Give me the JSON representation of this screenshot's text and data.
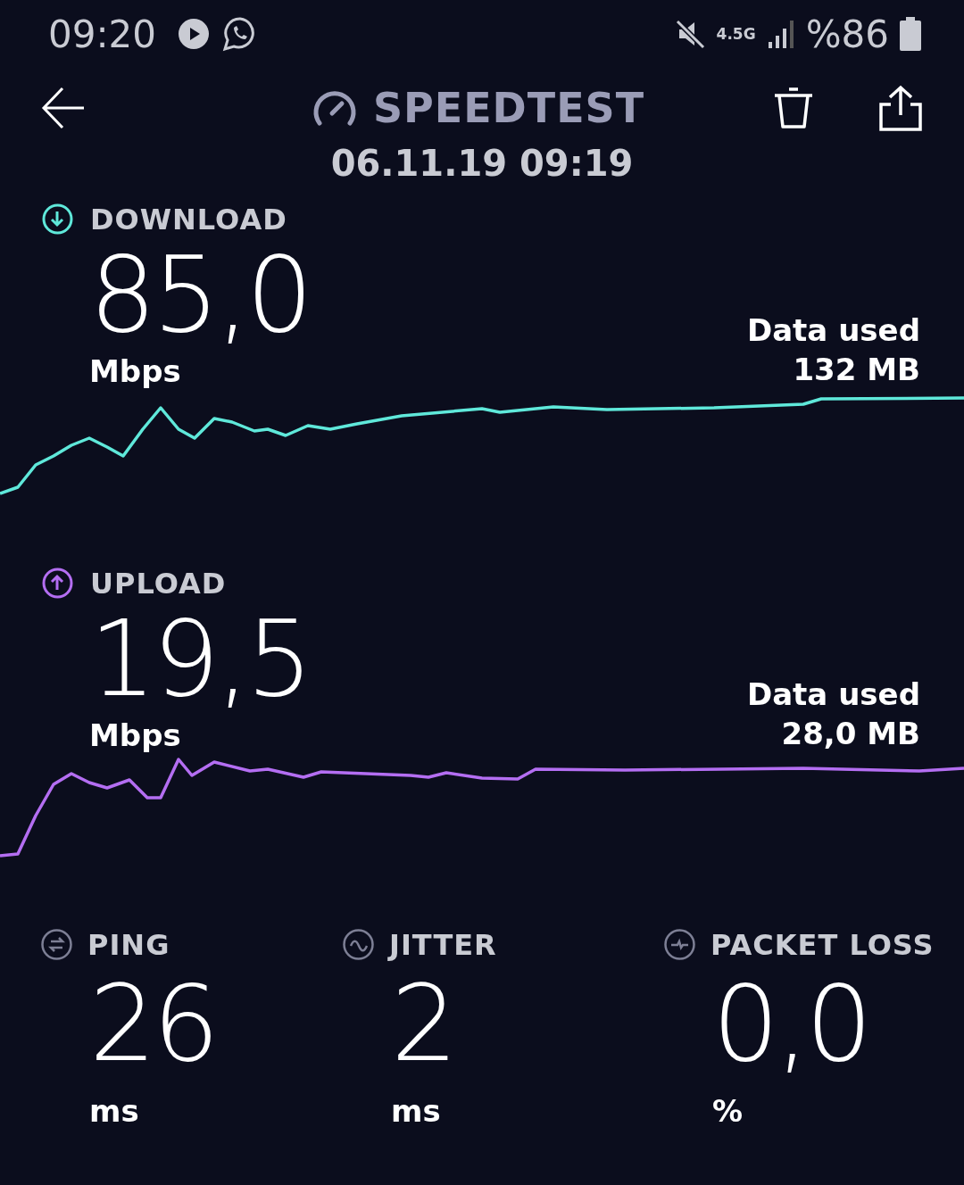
{
  "status_bar": {
    "time": "09:20",
    "network": "4.5G",
    "battery": "%86"
  },
  "header": {
    "title": "SPEEDTEST",
    "date": "06.11.19 09:19"
  },
  "tests": [
    {
      "kind": "download",
      "label": "DOWNLOAD",
      "value": "85,0",
      "unit": "Mbps",
      "data_used_label": "Data used",
      "data_used": "132 MB",
      "color": "#5fe8da"
    },
    {
      "kind": "upload",
      "label": "UPLOAD",
      "value": "19,5",
      "unit": "Mbps",
      "data_used_label": "Data used",
      "data_used": "28,0 MB",
      "color": "#b46ef2"
    }
  ],
  "metrics": [
    {
      "kind": "ping",
      "label": "PING",
      "value": "26",
      "unit": "ms"
    },
    {
      "kind": "jitter",
      "label": "JITTER",
      "value": "2",
      "unit": "ms"
    },
    {
      "kind": "packet_loss",
      "label": "PACKET LOSS",
      "value": "0,0",
      "unit": "%"
    }
  ]
}
